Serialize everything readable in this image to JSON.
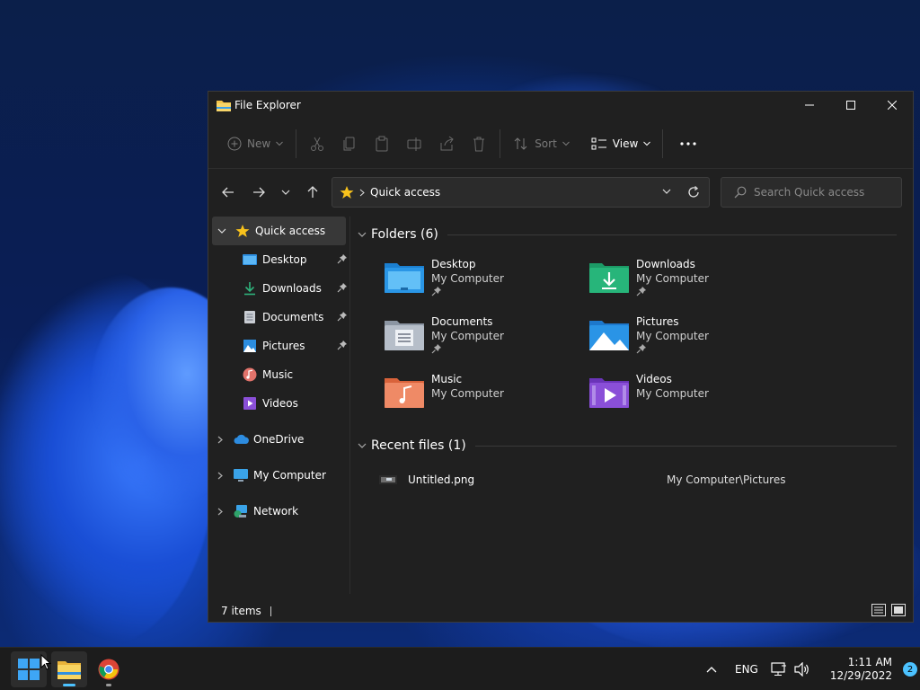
{
  "window": {
    "title": "File Explorer"
  },
  "toolbar": {
    "new_label": "New",
    "sort_label": "Sort",
    "view_label": "View"
  },
  "address": {
    "crumb": "Quick access"
  },
  "search": {
    "placeholder": "Search Quick access"
  },
  "sidebar": {
    "items": [
      {
        "label": "Quick access"
      },
      {
        "label": "Desktop"
      },
      {
        "label": "Downloads"
      },
      {
        "label": "Documents"
      },
      {
        "label": "Pictures"
      },
      {
        "label": "Music"
      },
      {
        "label": "Videos"
      },
      {
        "label": "OneDrive"
      },
      {
        "label": "My Computer"
      },
      {
        "label": "Network"
      }
    ]
  },
  "folders": {
    "heading": "Folders (6)",
    "items": [
      {
        "name": "Desktop",
        "location": "My Computer"
      },
      {
        "name": "Downloads",
        "location": "My Computer"
      },
      {
        "name": "Documents",
        "location": "My Computer"
      },
      {
        "name": "Pictures",
        "location": "My Computer"
      },
      {
        "name": "Music",
        "location": "My Computer"
      },
      {
        "name": "Videos",
        "location": "My Computer"
      }
    ]
  },
  "recent": {
    "heading": "Recent files (1)",
    "items": [
      {
        "name": "Untitled.png",
        "path": "My Computer\\Pictures"
      }
    ]
  },
  "status": {
    "items": "7 items"
  },
  "tray": {
    "language": "ENG",
    "time": "1:11 AM",
    "date": "12/29/2022",
    "notifications": "2"
  },
  "colors": {
    "accent": "#4cc2ff",
    "star": "#f8c21c",
    "window_bg": "#202020",
    "taskbar_bg": "#1c1c1c"
  }
}
